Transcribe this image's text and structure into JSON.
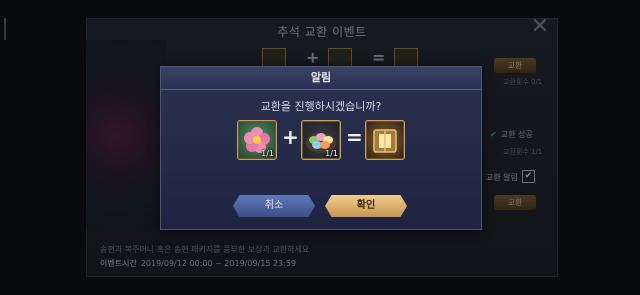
{
  "background": {
    "title": "추석 교환 이벤트",
    "right_buttons": [
      "교환",
      "교환",
      "교환"
    ],
    "counts": [
      "교환횟수 0/1",
      "교환횟수 1/1"
    ],
    "success_label": "교환 성공",
    "alert_label": "교환 알림",
    "description": "송편과 복주머니 혹은 송편 패키지를 풍부한 보상과 교환하세요",
    "period_label": "이벤트시간",
    "period_value": "2019/09/12 00:00 ~ 2019/09/15 23:59"
  },
  "modal": {
    "title": "알림",
    "question": "교환을 진행하시겠습니까?",
    "items": [
      {
        "icon": "flower-icon",
        "qty": "1/1"
      },
      {
        "icon": "songpyeon-plate-icon",
        "qty": "1/1"
      },
      {
        "icon": "treasure-box-icon"
      }
    ],
    "cancel_label": "취소",
    "confirm_label": "확인"
  },
  "colors": {
    "accent_gold": "#c89552",
    "cancel_blue": "#3b4f86",
    "success_green": "#4fd06a"
  }
}
